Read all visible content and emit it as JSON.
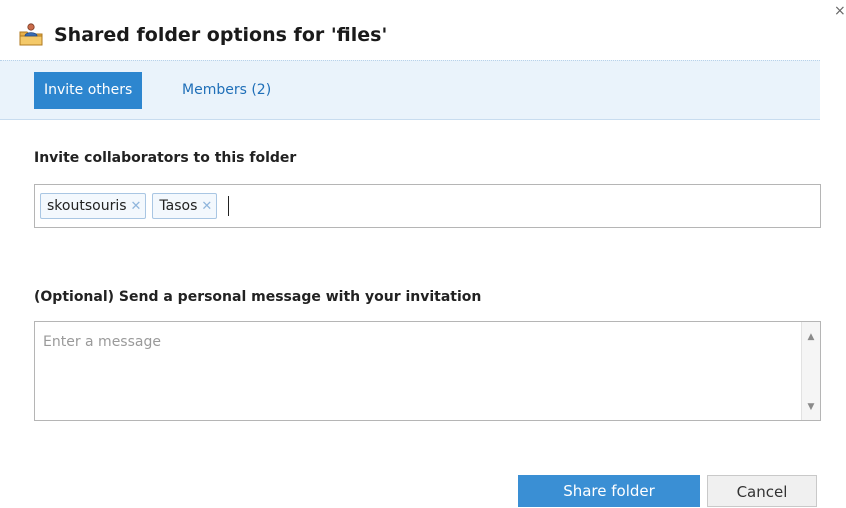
{
  "dialog": {
    "title": "Shared folder options for 'files'",
    "close_glyph": "×"
  },
  "tabs": [
    {
      "label": "Invite others",
      "active": true
    },
    {
      "label": "Members (2)",
      "active": false
    }
  ],
  "invite": {
    "label": "Invite collaborators to this folder",
    "recipients": [
      {
        "name": "skoutsouris",
        "remove_glyph": "✕"
      },
      {
        "name": "Tasos",
        "remove_glyph": "✕"
      }
    ],
    "input_value": ""
  },
  "message": {
    "label": "(Optional) Send a personal message with your invitation",
    "placeholder": "Enter a message",
    "value": ""
  },
  "buttons": {
    "share_label": "Share folder",
    "cancel_label": "Cancel"
  },
  "colors": {
    "accent": "#2d86cf",
    "tab_strip_bg": "#eaf3fb",
    "link": "#1f6fb8"
  },
  "icons": {
    "title": "shared-folder-icon",
    "close": "close-icon",
    "token_remove": "remove-token-icon",
    "scroll_up": "scroll-up-arrow-icon",
    "scroll_down": "scroll-down-arrow-icon"
  }
}
